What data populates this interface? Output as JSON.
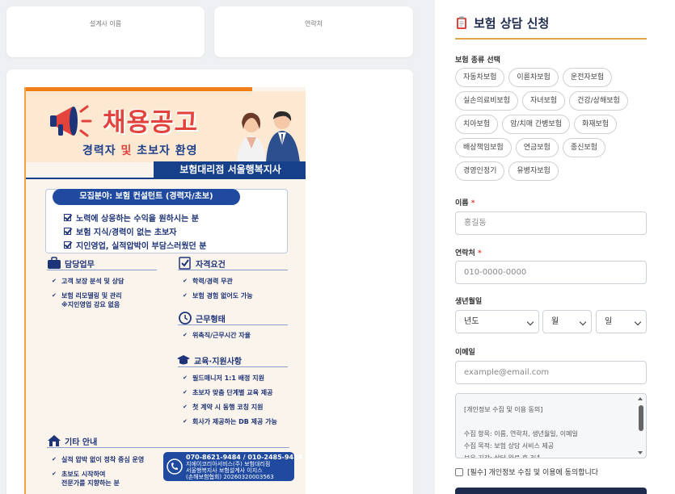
{
  "top_cards": {
    "designer_label": "설계사 이름",
    "contact_label": "연락처"
  },
  "poster": {
    "title": "채용공고",
    "subtitle_a": "경력자",
    "subtitle_and": "및",
    "subtitle_b": "초보자 환영",
    "agency": "보험대리점 서울행복지사",
    "recruit_field": "모집분야: 보험 컨설턴트 (경력자/초보)",
    "recruit_checks": [
      "노력에 상응하는 수익을 원하시는 분",
      "보험 지식/경력이 없는 초보자",
      "지인영업, 실적압박이 부담스러웠던 분"
    ],
    "duty": {
      "heading": "담당업무",
      "items": [
        "고객 보장 분석 및 상담",
        "보험 리모델링 및 관리",
        "※지인영업 강요 없음"
      ]
    },
    "qualification": {
      "heading": "자격요건",
      "items": [
        "학력/경력 무관",
        "보험 경험 없어도 가능"
      ]
    },
    "work_type": {
      "heading": "근무형태",
      "items": [
        "위촉직/근무시간 자율"
      ]
    },
    "education": {
      "heading": "교육·지원사항",
      "items": [
        "필드매니저 1:1 배정 지원",
        "초보자 맞춤 단계별 교육 제공",
        "첫 계약 시 동행 코칭 지원",
        "회사가 제공하는 DB 제공 가능"
      ]
    },
    "other": {
      "heading": "기타 안내",
      "items": [
        "실적 압박 없이 정착 중심 운영",
        "초보도 시작하여",
        "전문가를 지향하는 분"
      ]
    },
    "contact": {
      "phones": "070-8621-9484 / 010-2485-9484",
      "line2": "지에이코리아서비스(주) 보험대리점",
      "line3": "서울행복지사 보험설계사 이지스",
      "line4": "(손해보험협회) 20260320003563"
    }
  },
  "form": {
    "title": "보험 상담 신청",
    "insurance_type_label": "보험 종류 선택",
    "insurance_types": [
      "자동차보험",
      "이륜차보험",
      "운전자보험",
      "실손의료비보험",
      "자녀보험",
      "건강/상해보험",
      "치아보험",
      "암/치매 간병보험",
      "화재보험",
      "배상책임보험",
      "연금보험",
      "종신보험",
      "경영인정기",
      "유병자보험"
    ],
    "name_label": "이름",
    "required_mark": "*",
    "name_placeholder": "홍길동",
    "phone_label": "연락처",
    "phone_placeholder": "010-0000-0000",
    "birth_label": "생년월일",
    "birth_year": "년도",
    "birth_month": "월",
    "birth_day": "일",
    "email_label": "이메일",
    "email_placeholder": "example@email.com",
    "privacy_lines": [
      "[개인정보 수집 및 이용 동의]",
      "",
      "수집 항목: 이름, 연락처, 생년월일, 이메일",
      "수집 목적: 보험 상담 서비스 제공",
      "보유 기간: 상담 완료 후 3년"
    ],
    "agree_label": "[필수] 개인정보 수집 및 이용에 동의합니다"
  },
  "colors": {
    "accent_orange": "#f07f1a",
    "navy": "#1e2b4f",
    "poster_blue": "#1f4aa0",
    "poster_red": "#e2433c",
    "rule_gold": "#e2a34a"
  }
}
